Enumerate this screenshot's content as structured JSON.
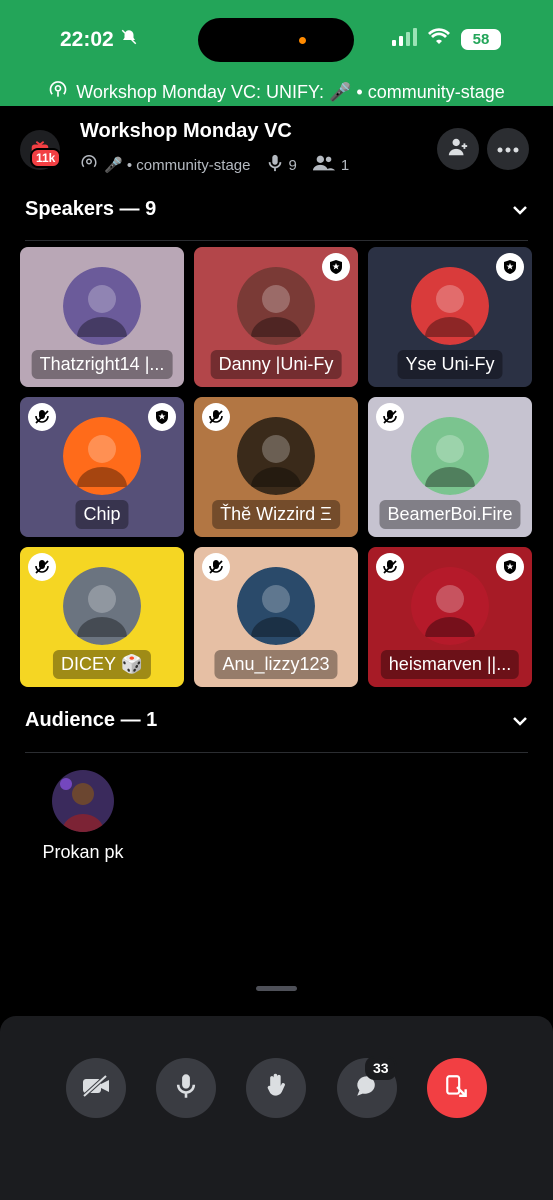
{
  "status_bar": {
    "time": "22:02",
    "battery": "58"
  },
  "stage_bar": {
    "text": "Workshop Monday VC: UNIFY: 🎤 • community-stage"
  },
  "header": {
    "server_badge": "11k",
    "title": "Workshop Monday VC",
    "subtitle": "🎤 • community-stage",
    "speaker_count": "9",
    "member_count": "1"
  },
  "speakers": {
    "heading": "Speakers — 9",
    "tiles": [
      {
        "name": "Thatzright14 |...",
        "bg": "#b9a7b6",
        "mod": false,
        "muted": false
      },
      {
        "name": "Danny |Uni-Fy",
        "bg": "#b3464a",
        "mod": true,
        "muted": false
      },
      {
        "name": "Yse Uni-Fy",
        "bg": "#2b3144",
        "mod": true,
        "muted": false
      },
      {
        "name": "Chip",
        "bg": "#565078",
        "mod": true,
        "muted": true
      },
      {
        "name": "Ťhĕ Wizzird Ξ",
        "bg": "#b27643",
        "mod": false,
        "muted": true
      },
      {
        "name": "BeamerBoi.Fire",
        "bg": "#c6c3d0",
        "mod": false,
        "muted": true
      },
      {
        "name": "DICEY 🎲",
        "bg": "#f5d623",
        "mod": false,
        "muted": true
      },
      {
        "name": "Anu_lizzy123",
        "bg": "#e6bfa4",
        "mod": false,
        "muted": true
      },
      {
        "name": "heismarven ||...",
        "bg": "#a71b26",
        "mod": true,
        "muted": true
      }
    ]
  },
  "audience": {
    "heading": "Audience — 1",
    "members": [
      {
        "name": "Prokan pk"
      }
    ]
  },
  "controls": {
    "chat_count": "33"
  },
  "colors": {
    "accent_green": "#23a559",
    "leave_red": "#f23f43"
  }
}
